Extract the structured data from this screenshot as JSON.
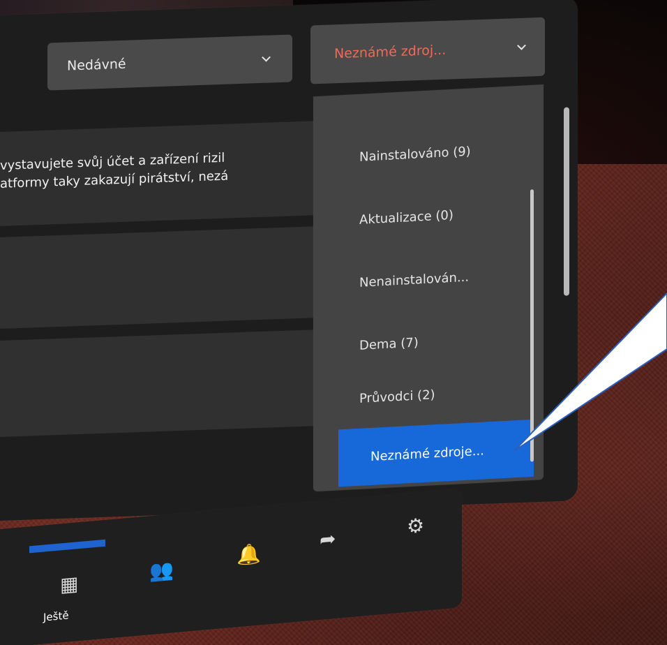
{
  "toolbar": {
    "recent_dropdown_label": "Nedávné",
    "source_dropdown_label": "Neznámé zdroj..."
  },
  "warning": {
    "line1": "vystavujete svůj účet a zařízení rizil",
    "line2": "atformy taky zakazují pirátství, nezá"
  },
  "menu": {
    "items": [
      {
        "label": "Nainstalováno (9)"
      },
      {
        "label": "Aktualizace (0)"
      },
      {
        "label": "Nenainstalován..."
      },
      {
        "label": "Dema (7)"
      },
      {
        "label": "Průvodci (2)"
      },
      {
        "label": "Neznámé zdroje..."
      }
    ]
  },
  "bottom_nav": {
    "library_label": "Ještě",
    "icons": [
      "library-icon",
      "people-icon",
      "bell-icon",
      "share-icon",
      "settings-icon"
    ]
  },
  "colors": {
    "accent_red": "#ef6b56",
    "selected_blue": "#1768d8",
    "active_indicator": "#1e63d0"
  }
}
